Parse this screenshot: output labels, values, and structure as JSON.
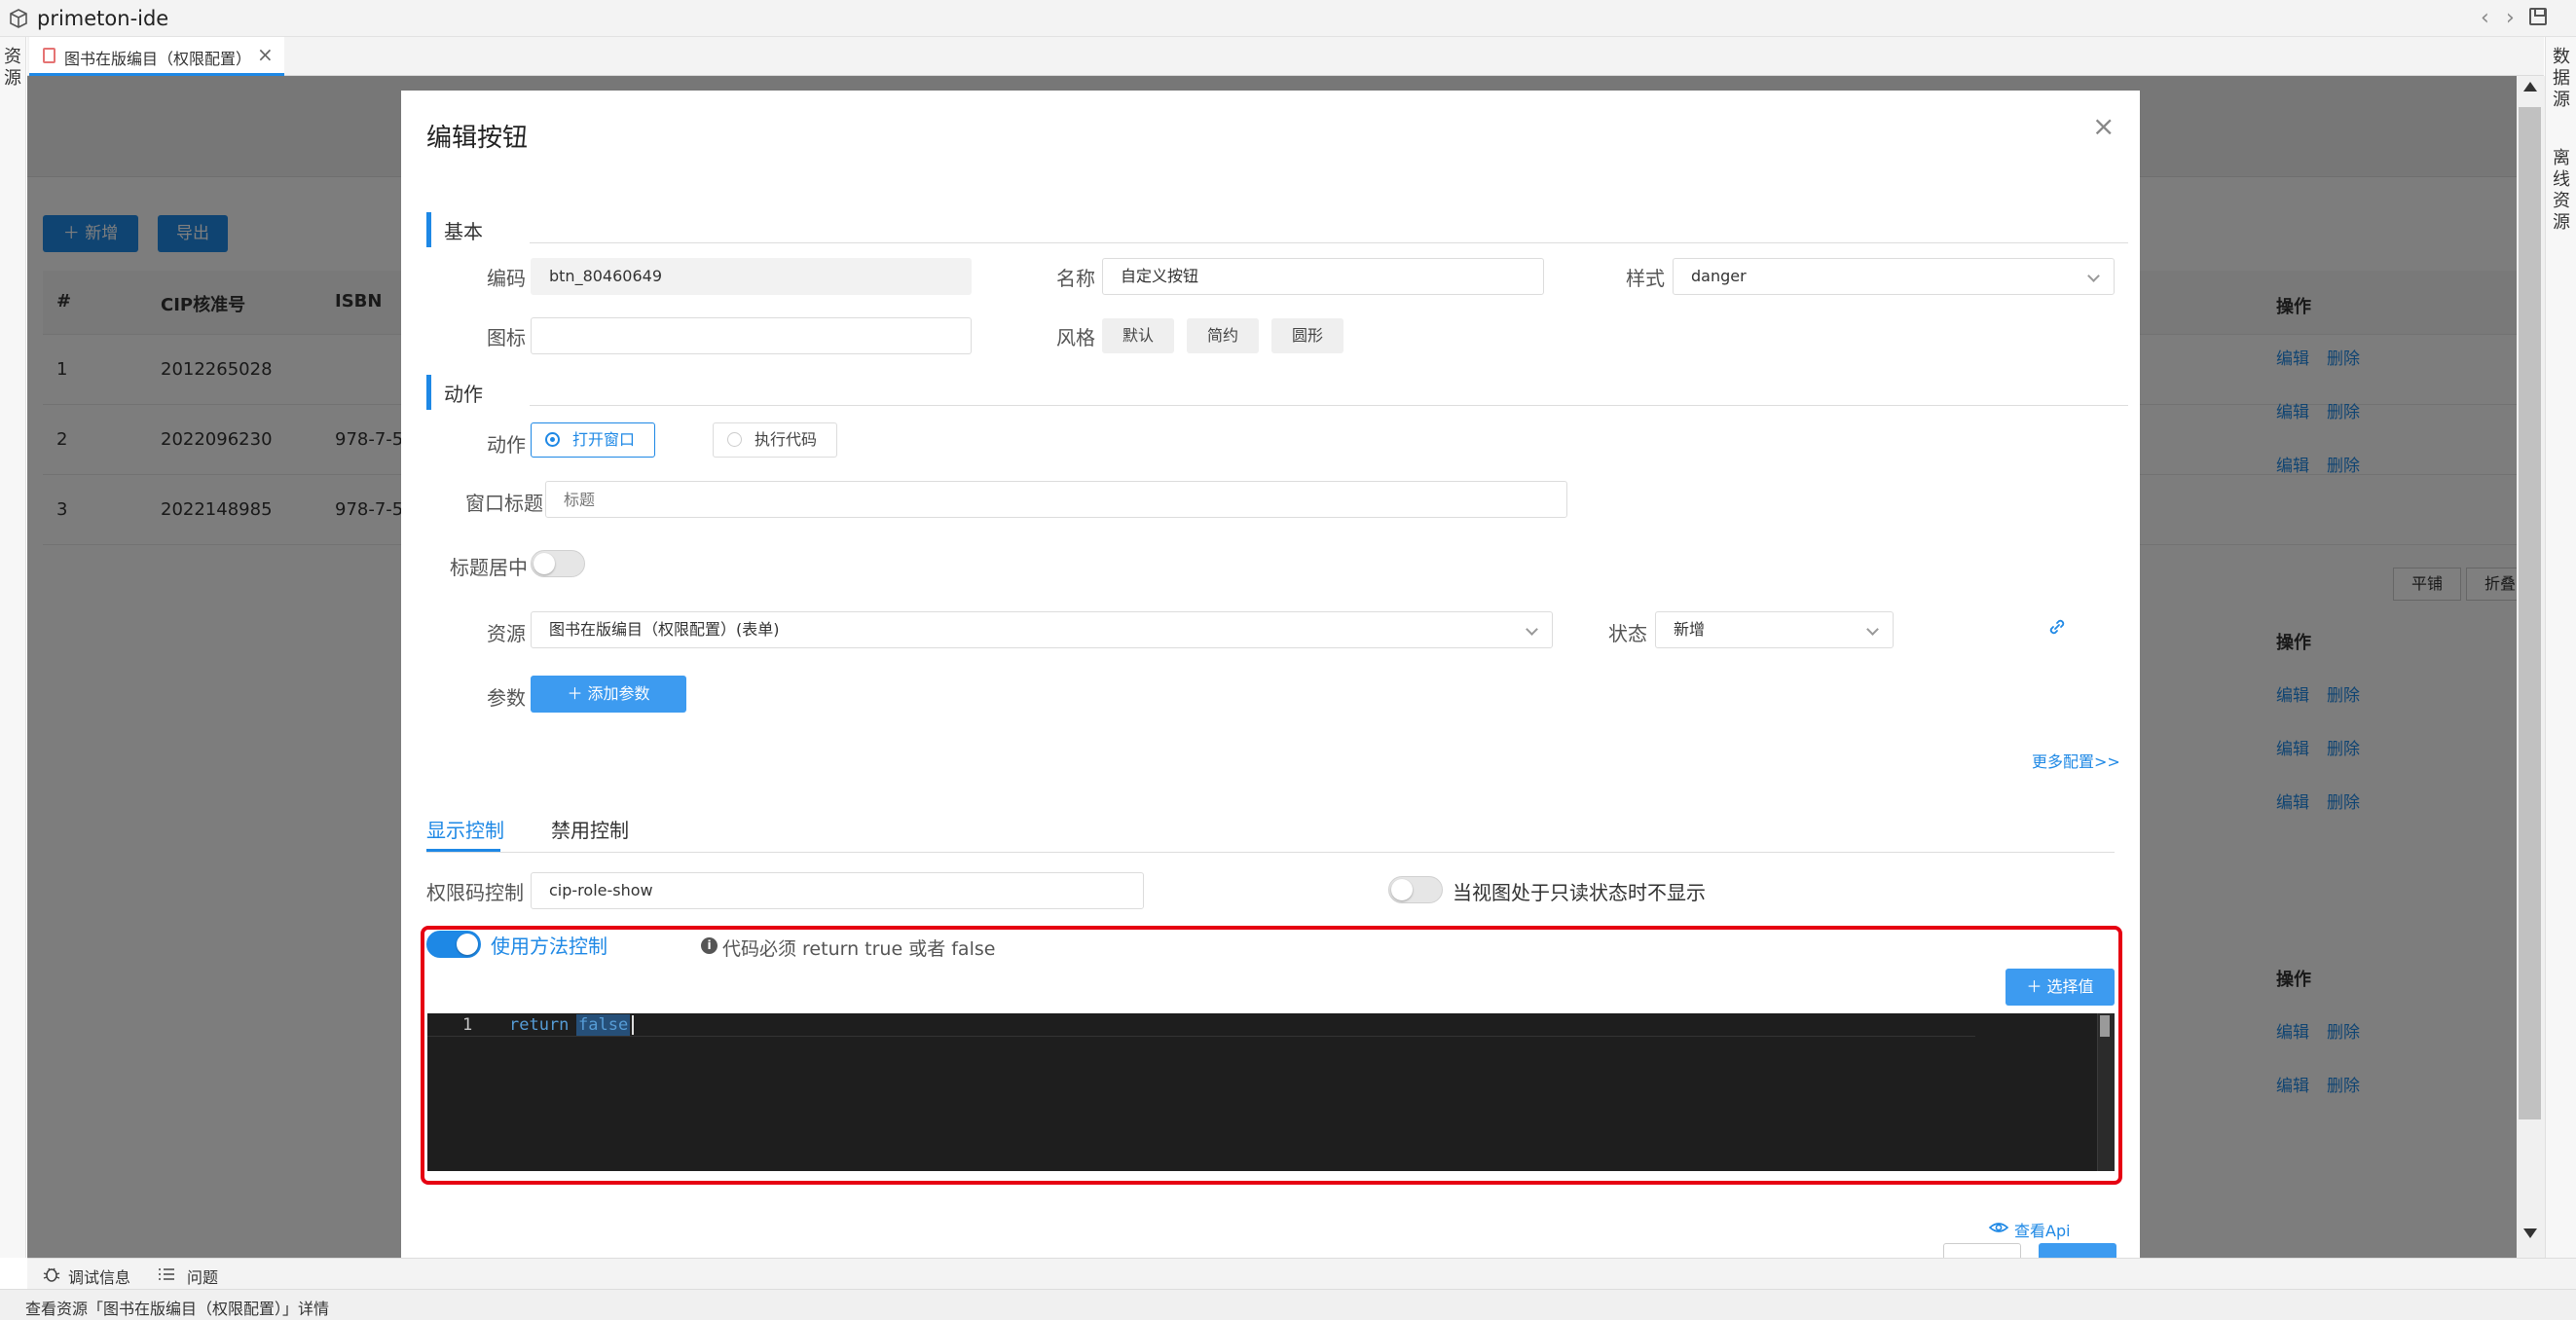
{
  "app": {
    "title": "primeton-ide"
  },
  "left_strip": {
    "label": "资源"
  },
  "right_strip": {
    "label_1": "数据源",
    "label_2": "离线资源"
  },
  "tab": {
    "label": "图书在版编目（权限配置）"
  },
  "background": {
    "add_label": "新增",
    "export_label": "导出",
    "columns": [
      "#",
      "CIP核准号",
      "ISBN"
    ],
    "rows": [
      [
        "1",
        "2012265028",
        ""
      ],
      [
        "2",
        "2022096230",
        "978-7-5"
      ],
      [
        "3",
        "2022148985",
        "978-7-5"
      ]
    ],
    "operations_header": "操作",
    "edit_label": "编辑",
    "delete_label": "删除",
    "tile_label": "平铺",
    "fold_label": "折叠"
  },
  "modal": {
    "title": "编辑按钮",
    "basic_section": "基本",
    "code_label": "编码",
    "code_value": "btn_80460649",
    "name_label": "名称",
    "name_value": "自定义按钮",
    "style_label": "样式",
    "style_value": "danger",
    "icon_label": "图标",
    "icon_value": "",
    "theme_label": "风格",
    "theme_options": [
      "默认",
      "简约",
      "圆形"
    ],
    "action_section": "动作",
    "action_label": "动作",
    "action_open": "打开窗口",
    "action_exec": "执行代码",
    "window_title_label": "窗口标题",
    "window_title_placeholder": "标题",
    "title_center_label": "标题居中",
    "resource_label": "资源",
    "resource_value": "图书在版编目（权限配置）(表单)",
    "status_label": "状态",
    "status_value": "新增",
    "params_label": "参数",
    "add_param_label": "添加参数",
    "more_config": "更多配置>>",
    "tab_show": "显示控制",
    "tab_disable": "禁用控制",
    "perm_label": "权限码控制",
    "perm_value": "cip-role-show",
    "readonly_hide_label": "当视图处于只读状态时不显示",
    "use_method_label": "使用方法控制",
    "method_hint": "代码必须 return true 或者 false",
    "select_value_label": "选择值",
    "code_line_number": "1",
    "code_keyword": "return",
    "code_value_text": "false",
    "view_api": "查看Api"
  },
  "debug": {
    "debug_info": "调试信息",
    "issues": "问题"
  },
  "status": {
    "text": "查看资源「图书在版编目（权限配置）」详情"
  },
  "colors": {
    "accent": "#1e88e5",
    "highlight": "#e60012",
    "editor_bg": "#1e1e1e"
  }
}
